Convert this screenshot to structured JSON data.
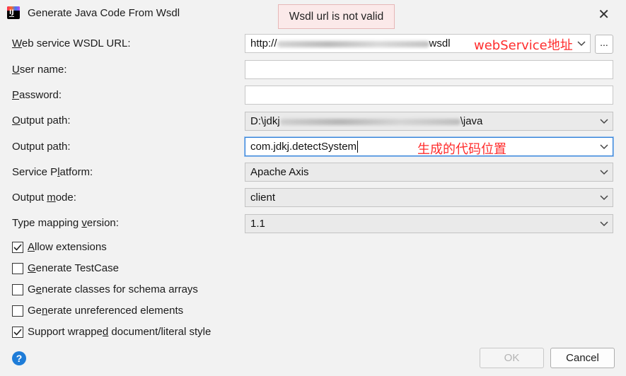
{
  "dialog": {
    "title": "Generate Java Code From Wsdl",
    "error_tip": "Wsdl url is not valid"
  },
  "fields": {
    "wsdl_url": {
      "label_mn": "W",
      "label_rest": "eb service WSDL URL:",
      "value_prefix": "http://",
      "value_suffix": "wsdl"
    },
    "user_name": {
      "label_mn": "U",
      "label_rest": "ser name:",
      "value": ""
    },
    "password": {
      "label_mn": "P",
      "label_rest": "assword:",
      "value": ""
    },
    "output_path": {
      "label_mn": "O",
      "label_rest": "utput path:",
      "value_prefix": "D:\\jdkj",
      "value_suffix": "\\java"
    },
    "package": {
      "label": "Output path:",
      "value": "com.jdkj.detectSystem"
    },
    "service_platform": {
      "label_pre": "Service P",
      "label_mn": "l",
      "label_rest": "atform:",
      "value": "Apache Axis"
    },
    "output_mode": {
      "label_pre": "Output ",
      "label_mn": "m",
      "label_rest": "ode:",
      "value": "client"
    },
    "type_mapping": {
      "label_pre": "Type mapping ",
      "label_mn": "v",
      "label_rest": "ersion:",
      "value": "1.1"
    }
  },
  "annotations": {
    "url_note": "webService地址",
    "package_note": "生成的代码位置"
  },
  "browse_button": "...",
  "checkboxes": [
    {
      "pre": "",
      "mn": "A",
      "rest": "llow extensions",
      "checked": true
    },
    {
      "pre": "",
      "mn": "G",
      "rest": "enerate TestCase",
      "checked": false
    },
    {
      "pre": "G",
      "mn": "e",
      "rest": "nerate classes for schema arrays",
      "checked": false
    },
    {
      "pre": "Ge",
      "mn": "n",
      "rest": "erate unreferenced elements",
      "checked": false
    },
    {
      "pre": "Support wrappe",
      "mn": "d",
      "rest": " document/literal style",
      "checked": true
    }
  ],
  "buttons": {
    "ok": "OK",
    "cancel": "Cancel"
  },
  "colors": {
    "accent": "#2f7fd8",
    "annotation": "#ff2d2d",
    "error_bg": "#fbe9e9",
    "help": "#1e7cd8"
  }
}
